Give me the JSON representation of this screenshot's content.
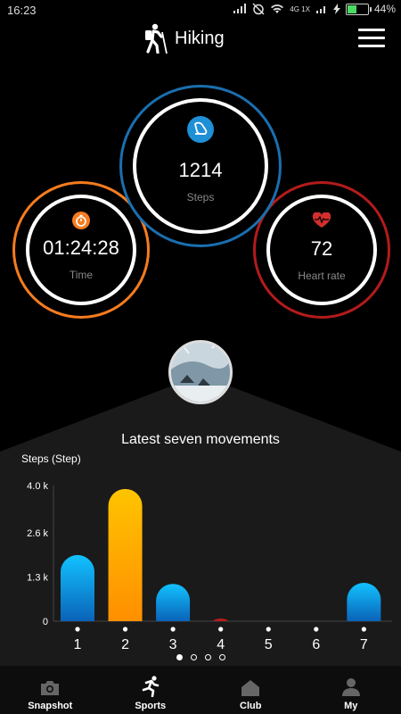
{
  "status": {
    "time": "16:23",
    "network": "4G 1X",
    "battery": "44%"
  },
  "header": {
    "title": "Hiking"
  },
  "rings": {
    "steps": {
      "value": "1214",
      "label": "Steps"
    },
    "time": {
      "value": "01:24:28",
      "label": "Time"
    },
    "heart": {
      "value": "72",
      "label": "Heart rate"
    }
  },
  "colors": {
    "steps_ring": "#1a6fb0",
    "time_ring": "#f57c1f",
    "heart_ring": "#b31b1b",
    "bar_blue": "#0a9fe0",
    "bar_orange": "#ffb300"
  },
  "chart_title": "Latest seven movements",
  "chart_data": {
    "type": "bar",
    "ylabel": "Steps (Step)",
    "yticks": [
      "4.0 k",
      "2.6 k",
      "1.3 k",
      "0"
    ],
    "ylim": [
      0,
      4000
    ],
    "categories": [
      "1",
      "2",
      "3",
      "4",
      "5",
      "6",
      "7"
    ],
    "values": [
      1950,
      3900,
      1100,
      0,
      0,
      0,
      1130
    ],
    "highlight_index": 1
  },
  "pager": {
    "count": 4,
    "active": 0
  },
  "tabs": [
    {
      "label": "Snapshot",
      "icon": "camera-icon"
    },
    {
      "label": "Sports",
      "icon": "runner-icon"
    },
    {
      "label": "Club",
      "icon": "home-icon"
    },
    {
      "label": "My",
      "icon": "person-icon"
    }
  ]
}
